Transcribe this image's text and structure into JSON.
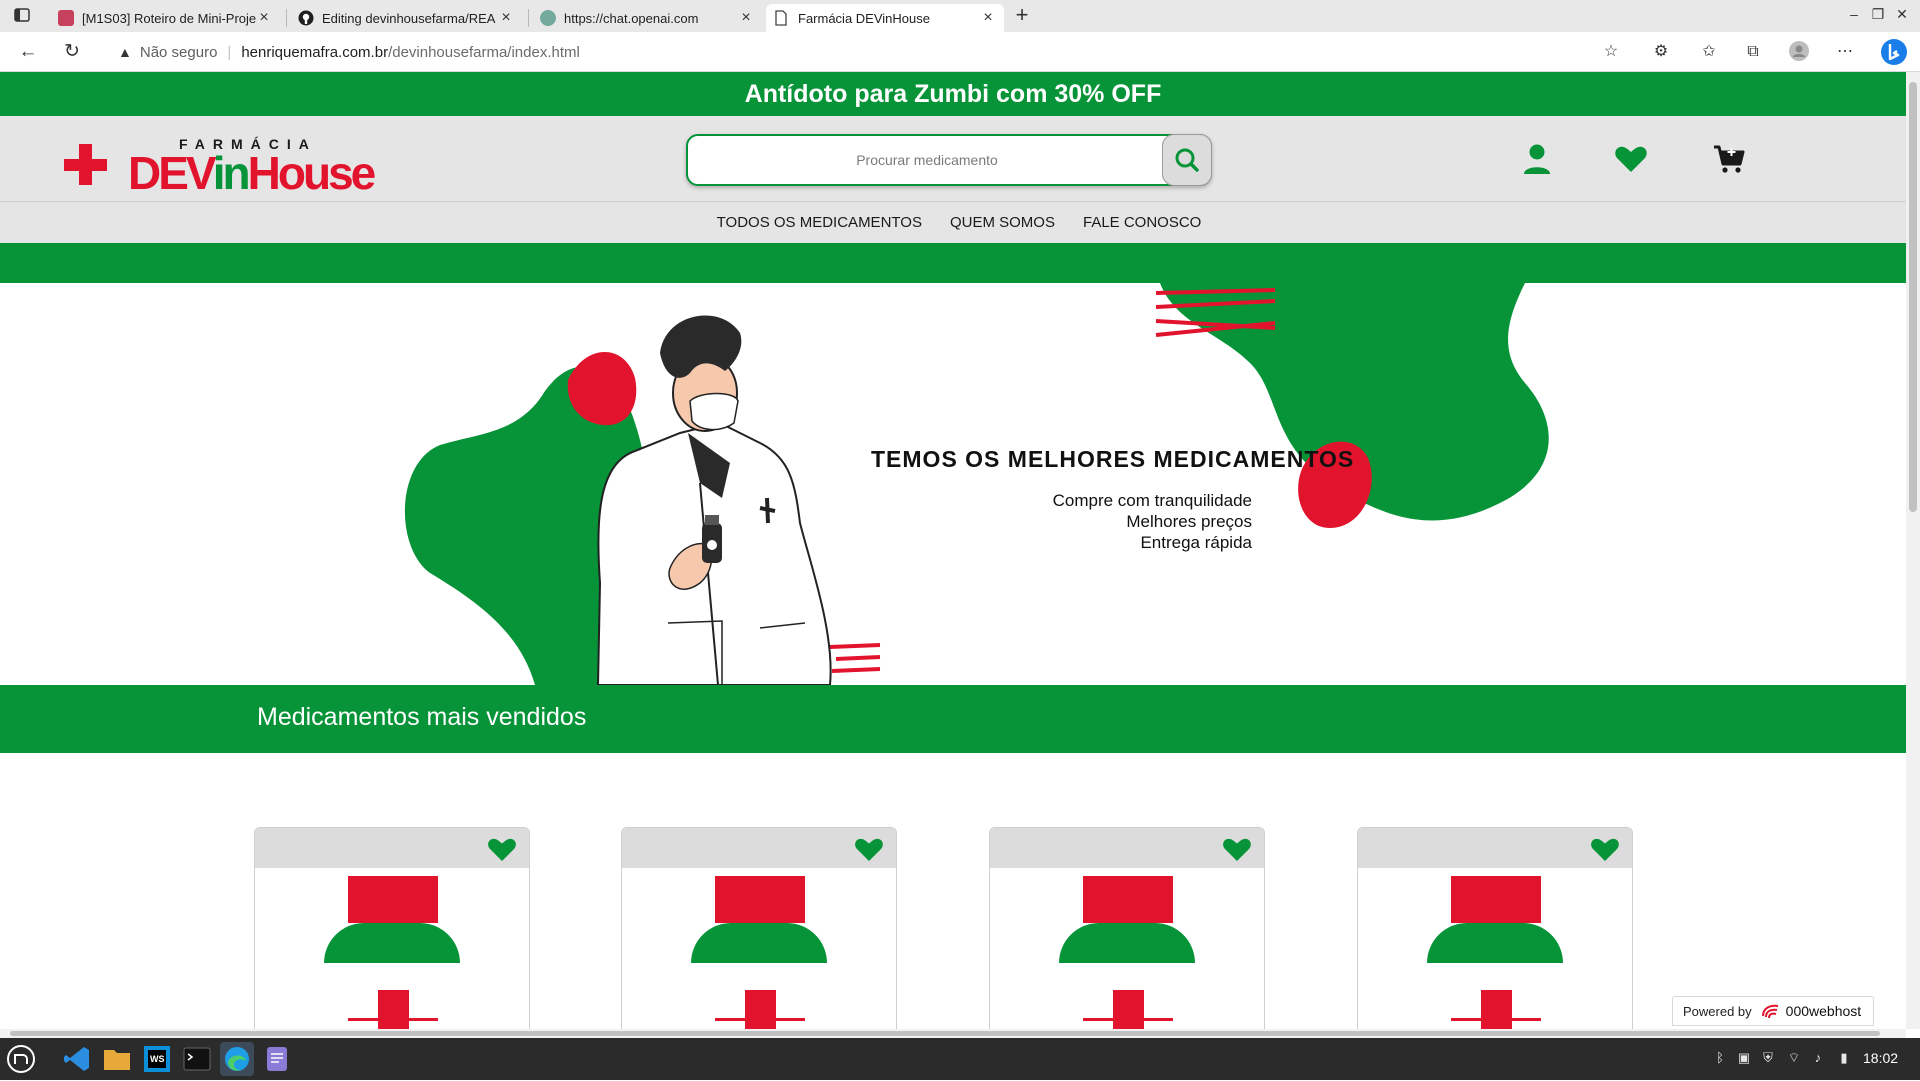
{
  "browser": {
    "tabs": [
      {
        "title": "[M1S03] Roteiro de Mini-Proje",
        "icon": "trello-icon"
      },
      {
        "title": "Editing devinhousefarma/REA",
        "icon": "github-icon"
      },
      {
        "title": "https://chat.openai.com",
        "icon": "chatgpt-icon"
      },
      {
        "title": "Farmácia DEVinHouse",
        "icon": "page-icon",
        "active": true
      }
    ],
    "security_label": "Não seguro",
    "url_host": "henriquemafra.com.br",
    "url_path": "/devinhousefarma/index.html"
  },
  "site": {
    "promo": "Antídoto para Zumbi com 30% OFF",
    "logo": {
      "top": "FARMÁCIA",
      "brand_a": "DEV",
      "brand_b": "in",
      "brand_c": "House"
    },
    "search_placeholder": "Procurar medicamento",
    "nav": [
      "TODOS OS MEDICAMENTOS",
      "QUEM SOMOS",
      "FALE CONOSCO"
    ],
    "hero": {
      "heading": "TEMOS OS MELHORES MEDICAMENTOS",
      "lines": [
        "Compre com tranquilidade",
        "Melhores preços",
        "Entrega rápida"
      ]
    },
    "best_sellers_title": "Medicamentos mais vendidos",
    "powered_label": "Powered by",
    "powered_host": "000webhost"
  },
  "taskbar": {
    "apps": [
      "linux-mint-menu",
      "vscode",
      "file-manager",
      "webstorm",
      "terminal",
      "edge",
      "text-editor"
    ],
    "clock": "18:02"
  },
  "colors": {
    "brand_green": "#079438",
    "brand_red": "#e2142d",
    "header_gray": "#e5e5e6"
  }
}
